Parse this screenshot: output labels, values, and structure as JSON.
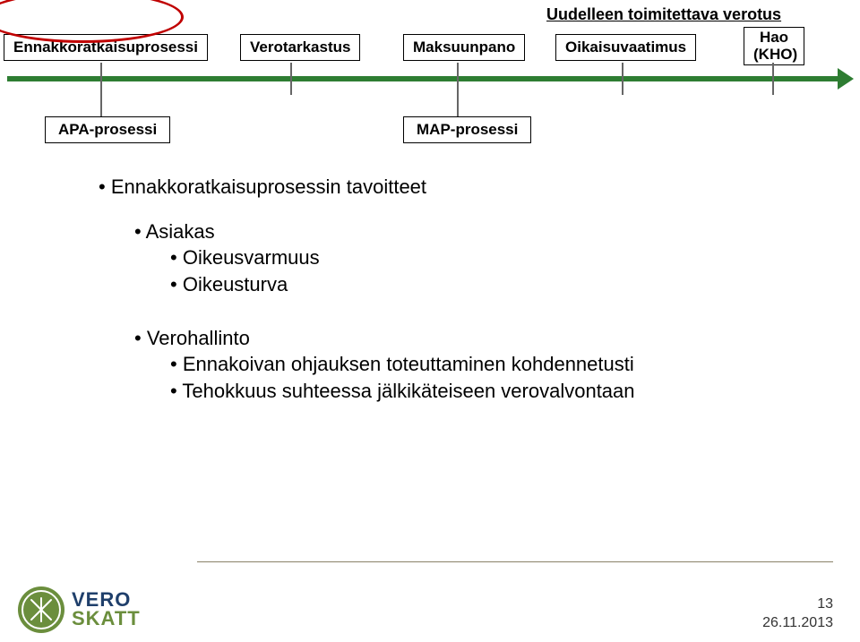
{
  "header": {
    "label": "Uudelleen toimitettava verotus"
  },
  "phases": [
    {
      "label": "Ennakkoratkaisuprosessi"
    },
    {
      "label": "Verotarkastus"
    },
    {
      "label": "Maksuunpano"
    },
    {
      "label": "Oikaisuvaatimus"
    },
    {
      "line1": "Hao",
      "line2": "(KHO)"
    }
  ],
  "subboxes": [
    {
      "label": "APA-prosessi"
    },
    {
      "label": "MAP-prosessi"
    }
  ],
  "bullets": {
    "b1": "Ennakkoratkaisuprosessin tavoitteet",
    "b2": "Asiakas",
    "b2a": "Oikeusvarmuus",
    "b2b": "Oikeusturva",
    "b3": "Verohallinto",
    "b3a": "Ennakoivan ohjauksen toteuttaminen kohdennetusti",
    "b3b": "Tehokkuus suhteessa jälkikäteiseen verovalvontaan"
  },
  "logo": {
    "word1": "VERO",
    "word2": "SKATT"
  },
  "footer": {
    "page": "13",
    "date": "26.11.2013"
  }
}
